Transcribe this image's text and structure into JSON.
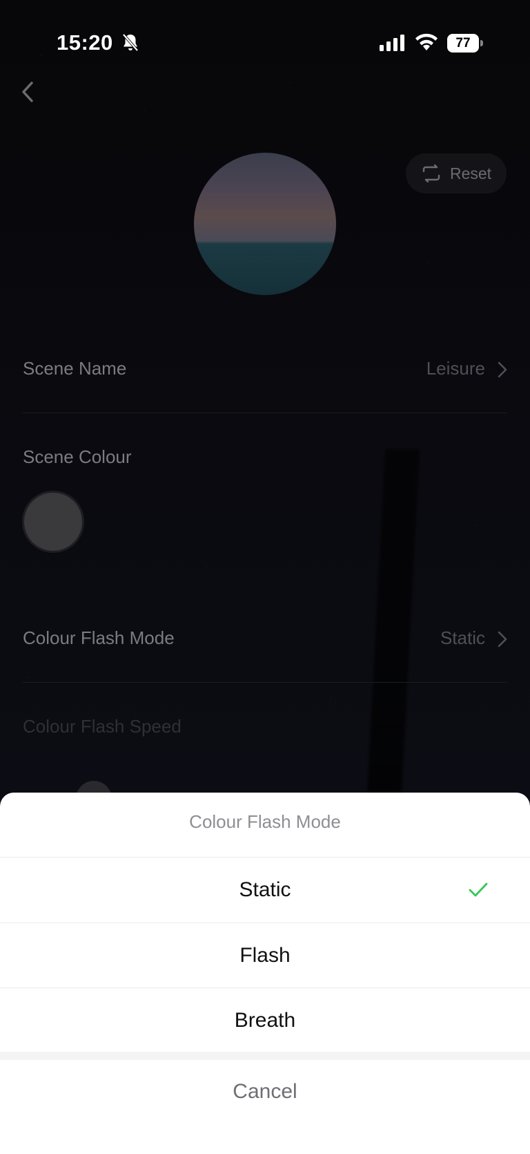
{
  "status_bar": {
    "time": "15:20",
    "battery_level": "77",
    "icons": [
      "bell-muted-icon",
      "cellular-signal-icon",
      "wifi-icon",
      "battery-icon"
    ]
  },
  "header": {
    "back_icon": "chevron-left-icon",
    "reset_label": "Reset",
    "reset_icon": "repeat-icon"
  },
  "scene": {
    "name_label": "Scene Name",
    "name_value": "Leisure",
    "colour_label": "Scene Colour",
    "flash_mode_label": "Colour Flash Mode",
    "flash_mode_value": "Static",
    "flash_speed_label": "Colour Flash Speed"
  },
  "sheet": {
    "title": "Colour Flash Mode",
    "options": [
      {
        "label": "Static",
        "selected": true
      },
      {
        "label": "Flash",
        "selected": false
      },
      {
        "label": "Breath",
        "selected": false
      }
    ],
    "cancel_label": "Cancel",
    "check_color": "#34c759"
  },
  "colors": {
    "overlay_text": "#7b7b80",
    "sheet_background": "#ffffff",
    "swatch": "#3a3a3d"
  }
}
